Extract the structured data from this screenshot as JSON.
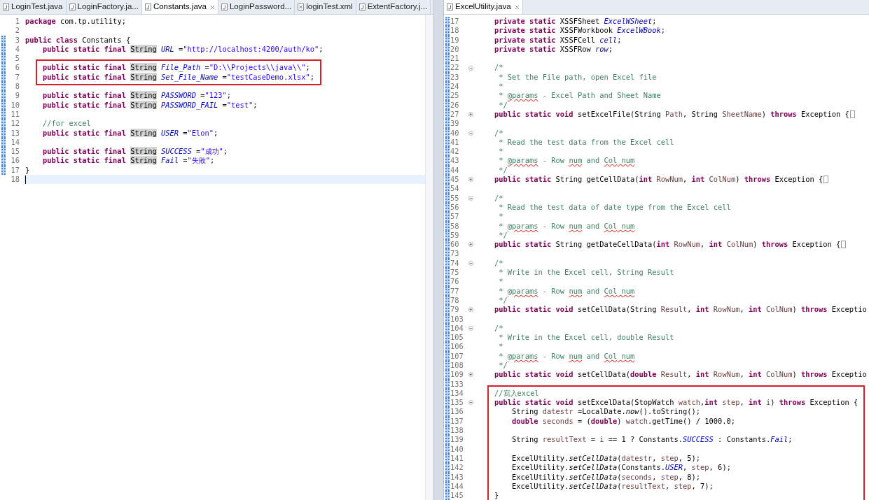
{
  "panes": [
    {
      "tabs": [
        {
          "label": "LoginTest.java",
          "kind": "java",
          "selected": false
        },
        {
          "label": "LoginFactory.ja...",
          "kind": "java",
          "selected": false
        },
        {
          "label": "Constants.java",
          "kind": "java",
          "selected": true
        },
        {
          "label": "LoginPassword...",
          "kind": "java",
          "selected": false
        },
        {
          "label": "loginTest.xml",
          "kind": "xml",
          "selected": false
        },
        {
          "label": "ExtentFactory.j...",
          "kind": "java",
          "selected": false
        }
      ],
      "blocks": [
        {
          "boxed": false,
          "lines": [
            {
              "n": "1",
              "changed": false,
              "segs": [
                {
                  "kind": "kw",
                  "text": "package"
                },
                {
                  "kind": "plain",
                  "text": " com.tp.utility;"
                }
              ]
            },
            {
              "n": "2",
              "changed": false
            },
            {
              "n": "3",
              "changed": true,
              "segs": [
                {
                  "kind": "kw",
                  "text": "public class"
                },
                {
                  "kind": "plain",
                  "text": " Constants {"
                }
              ]
            },
            {
              "n": "4",
              "changed": true,
              "segs": [
                {
                  "kind": "kw",
                  "text": "    public static final "
                },
                {
                  "kind": "hl",
                  "text": "String"
                },
                {
                  "kind": "field",
                  "text": " URL"
                },
                {
                  "kind": "plain",
                  "text": " ="
                },
                {
                  "kind": "str",
                  "text": "\"http://localhost:4200/auth/ko\""
                },
                {
                  "kind": "plain",
                  "text": ";"
                }
              ]
            },
            {
              "n": "5",
              "changed": true
            }
          ]
        },
        {
          "boxed": true,
          "lines": [
            {
              "n": "6",
              "changed": true,
              "segs": [
                {
                  "kind": "kw",
                  "text": "    public static final "
                },
                {
                  "kind": "hl",
                  "text": "String"
                },
                {
                  "kind": "field",
                  "text": " File_Path"
                },
                {
                  "kind": "plain",
                  "text": " ="
                },
                {
                  "kind": "str",
                  "text": "\"D:\\\\Projects\\\\java\\\\\""
                },
                {
                  "kind": "plain",
                  "text": ";"
                }
              ]
            },
            {
              "n": "7",
              "changed": true,
              "segs": [
                {
                  "kind": "kw",
                  "text": "    public static final "
                },
                {
                  "kind": "hl",
                  "text": "String"
                },
                {
                  "kind": "field",
                  "text": " Set_File_Name"
                },
                {
                  "kind": "plain",
                  "text": " ="
                },
                {
                  "kind": "str",
                  "text": "\"testCaseDemo.xlsx\""
                },
                {
                  "kind": "plain",
                  "text": ";"
                }
              ]
            }
          ]
        },
        {
          "boxed": false,
          "lines": [
            {
              "n": "8",
              "changed": true
            },
            {
              "n": "9",
              "changed": true,
              "segs": [
                {
                  "kind": "kw",
                  "text": "    public static final "
                },
                {
                  "kind": "hl",
                  "text": "String"
                },
                {
                  "kind": "field",
                  "text": " PASSWORD"
                },
                {
                  "kind": "plain",
                  "text": " ="
                },
                {
                  "kind": "str",
                  "text": "\"123\""
                },
                {
                  "kind": "plain",
                  "text": ";"
                }
              ]
            },
            {
              "n": "10",
              "changed": true,
              "segs": [
                {
                  "kind": "kw",
                  "text": "    public static final "
                },
                {
                  "kind": "hl",
                  "text": "String"
                },
                {
                  "kind": "field",
                  "text": " PASSWORD_FAIL"
                },
                {
                  "kind": "plain",
                  "text": " ="
                },
                {
                  "kind": "str",
                  "text": "\"test\""
                },
                {
                  "kind": "plain",
                  "text": ";"
                }
              ]
            },
            {
              "n": "11",
              "changed": true
            },
            {
              "n": "12",
              "changed": true,
              "segs": [
                {
                  "kind": "comment",
                  "text": "    //for excel"
                }
              ]
            },
            {
              "n": "13",
              "changed": true,
              "segs": [
                {
                  "kind": "kw",
                  "text": "    public static final "
                },
                {
                  "kind": "hl",
                  "text": "String"
                },
                {
                  "kind": "field",
                  "text": " USER"
                },
                {
                  "kind": "plain",
                  "text": " ="
                },
                {
                  "kind": "str",
                  "text": "\"Elon\""
                },
                {
                  "kind": "plain",
                  "text": ";"
                }
              ]
            },
            {
              "n": "14",
              "changed": true
            },
            {
              "n": "15",
              "changed": true,
              "segs": [
                {
                  "kind": "kw",
                  "text": "    public static final "
                },
                {
                  "kind": "hl",
                  "text": "String"
                },
                {
                  "kind": "field",
                  "text": " SUCCESS"
                },
                {
                  "kind": "plain",
                  "text": " ="
                },
                {
                  "kind": "str",
                  "text": "\"成功\""
                },
                {
                  "kind": "plain",
                  "text": ";"
                }
              ]
            },
            {
              "n": "16",
              "changed": true,
              "segs": [
                {
                  "kind": "kw",
                  "text": "    public static final "
                },
                {
                  "kind": "hl",
                  "text": "String"
                },
                {
                  "kind": "field",
                  "text": " Fail"
                },
                {
                  "kind": "plain",
                  "text": " ="
                },
                {
                  "kind": "str",
                  "text": "\"失敗\""
                },
                {
                  "kind": "plain",
                  "text": ";"
                }
              ]
            },
            {
              "n": "17",
              "changed": true,
              "segs": [
                {
                  "kind": "plain",
                  "text": "}"
                }
              ]
            },
            {
              "n": "18",
              "changed": false,
              "current": true
            }
          ]
        }
      ]
    },
    {
      "tabs": [
        {
          "label": "ExcelUtility.java",
          "kind": "java",
          "selected": true
        }
      ],
      "blocks": [
        {
          "boxed": false,
          "lines": [
            {
              "n": "17",
              "changed": true,
              "segs": [
                {
                  "kind": "kw",
                  "text": "    private static"
                },
                {
                  "kind": "plain",
                  "text": " XSSFSheet "
                },
                {
                  "kind": "field",
                  "text": "ExcelWSheet"
                },
                {
                  "kind": "plain",
                  "text": ";"
                }
              ]
            },
            {
              "n": "18",
              "changed": true,
              "segs": [
                {
                  "kind": "kw",
                  "text": "    private static"
                },
                {
                  "kind": "plain",
                  "text": " XSSFWorkbook "
                },
                {
                  "kind": "field",
                  "text": "ExcelWBook"
                },
                {
                  "kind": "plain",
                  "text": ";"
                }
              ]
            },
            {
              "n": "19",
              "changed": true,
              "segs": [
                {
                  "kind": "kw",
                  "text": "    private static"
                },
                {
                  "kind": "plain",
                  "text": " XSSFCell "
                },
                {
                  "kind": "field",
                  "text": "cell"
                },
                {
                  "kind": "plain",
                  "text": ";"
                }
              ]
            },
            {
              "n": "20",
              "changed": true,
              "segs": [
                {
                  "kind": "kw",
                  "text": "    private static"
                },
                {
                  "kind": "plain",
                  "text": " XSSFRow "
                },
                {
                  "kind": "field",
                  "text": "row"
                },
                {
                  "kind": "plain",
                  "text": ";"
                }
              ]
            },
            {
              "n": "21",
              "changed": true
            },
            {
              "n": "22",
              "changed": true,
              "expanded": true,
              "segs": [
                {
                  "kind": "comment",
                  "text": "    /*"
                }
              ]
            },
            {
              "n": "23",
              "changed": true,
              "segs": [
                {
                  "kind": "comment",
                  "text": "     * Set the File path, open Excel file"
                }
              ]
            },
            {
              "n": "24",
              "changed": true,
              "segs": [
                {
                  "kind": "comment",
                  "text": "     *"
                }
              ]
            },
            {
              "n": "25",
              "changed": true,
              "segs": [
                {
                  "kind": "comment",
                  "text": "     * "
                },
                {
                  "kind": "typo",
                  "text": "@params"
                },
                {
                  "kind": "comment",
                  "text": " - Excel Path and Sheet Name"
                }
              ]
            },
            {
              "n": "26",
              "changed": true,
              "segs": [
                {
                  "kind": "comment",
                  "text": "     */"
                }
              ]
            },
            {
              "n": "27",
              "changed": true,
              "expanded": false,
              "stub": true,
              "segs": [
                {
                  "kind": "kw",
                  "text": "    public static void"
                },
                {
                  "kind": "plain",
                  "text": " setExcelFile(String "
                },
                {
                  "kind": "var",
                  "text": "Path"
                },
                {
                  "kind": "plain",
                  "text": ", String "
                },
                {
                  "kind": "var",
                  "text": "SheetName"
                },
                {
                  "kind": "plain",
                  "text": ") "
                },
                {
                  "kind": "kw",
                  "text": "throws"
                },
                {
                  "kind": "plain",
                  "text": " Exception {"
                }
              ]
            },
            {
              "n": "39",
              "changed": true
            },
            {
              "n": "40",
              "changed": true,
              "expanded": true,
              "segs": [
                {
                  "kind": "comment",
                  "text": "    /*"
                }
              ]
            },
            {
              "n": "41",
              "changed": true,
              "segs": [
                {
                  "kind": "comment",
                  "text": "     * Read the test data from the Excel cell"
                }
              ]
            },
            {
              "n": "42",
              "changed": true,
              "segs": [
                {
                  "kind": "comment",
                  "text": "     *"
                }
              ]
            },
            {
              "n": "43",
              "changed": true,
              "segs": [
                {
                  "kind": "comment",
                  "text": "     * "
                },
                {
                  "kind": "typo",
                  "text": "@params"
                },
                {
                  "kind": "comment",
                  "text": " - Row "
                },
                {
                  "kind": "typo",
                  "text": "num"
                },
                {
                  "kind": "comment",
                  "text": " and "
                },
                {
                  "kind": "typo",
                  "text": "Col"
                },
                {
                  "kind": "typo",
                  "text": " num"
                }
              ]
            },
            {
              "n": "44",
              "changed": true,
              "segs": [
                {
                  "kind": "comment",
                  "text": "     */"
                }
              ]
            },
            {
              "n": "45",
              "changed": true,
              "expanded": false,
              "stub": true,
              "segs": [
                {
                  "kind": "kw",
                  "text": "    public static"
                },
                {
                  "kind": "plain",
                  "text": " String getCellData("
                },
                {
                  "kind": "kw",
                  "text": "int"
                },
                {
                  "kind": "var",
                  "text": " RowNum"
                },
                {
                  "kind": "plain",
                  "text": ", "
                },
                {
                  "kind": "kw",
                  "text": "int"
                },
                {
                  "kind": "var",
                  "text": " ColNum"
                },
                {
                  "kind": "plain",
                  "text": ") "
                },
                {
                  "kind": "kw",
                  "text": "throws"
                },
                {
                  "kind": "plain",
                  "text": " Exception {"
                }
              ]
            },
            {
              "n": "54",
              "changed": true
            },
            {
              "n": "55",
              "changed": true,
              "expanded": true,
              "segs": [
                {
                  "kind": "comment",
                  "text": "    /*"
                }
              ]
            },
            {
              "n": "56",
              "changed": true,
              "segs": [
                {
                  "kind": "comment",
                  "text": "     * Read the test data of date type from the Excel cell"
                }
              ]
            },
            {
              "n": "57",
              "changed": true,
              "segs": [
                {
                  "kind": "comment",
                  "text": "     *"
                }
              ]
            },
            {
              "n": "58",
              "changed": true,
              "segs": [
                {
                  "kind": "comment",
                  "text": "     * "
                },
                {
                  "kind": "typo",
                  "text": "@params"
                },
                {
                  "kind": "comment",
                  "text": " - Row "
                },
                {
                  "kind": "typo",
                  "text": "num"
                },
                {
                  "kind": "comment",
                  "text": " and "
                },
                {
                  "kind": "typo",
                  "text": "Col"
                },
                {
                  "kind": "typo",
                  "text": " num"
                }
              ]
            },
            {
              "n": "59",
              "changed": true,
              "segs": [
                {
                  "kind": "comment",
                  "text": "     */"
                }
              ]
            },
            {
              "n": "60",
              "changed": true,
              "expanded": false,
              "stub": true,
              "segs": [
                {
                  "kind": "kw",
                  "text": "    public static"
                },
                {
                  "kind": "plain",
                  "text": " String getDateCellData("
                },
                {
                  "kind": "kw",
                  "text": "int"
                },
                {
                  "kind": "var",
                  "text": " RowNum"
                },
                {
                  "kind": "plain",
                  "text": ", "
                },
                {
                  "kind": "kw",
                  "text": "int"
                },
                {
                  "kind": "var",
                  "text": " ColNum"
                },
                {
                  "kind": "plain",
                  "text": ") "
                },
                {
                  "kind": "kw",
                  "text": "throws"
                },
                {
                  "kind": "plain",
                  "text": " Exception {"
                }
              ]
            },
            {
              "n": "73",
              "changed": true
            },
            {
              "n": "74",
              "changed": true,
              "expanded": true,
              "segs": [
                {
                  "kind": "comment",
                  "text": "    /*"
                }
              ]
            },
            {
              "n": "75",
              "changed": true,
              "segs": [
                {
                  "kind": "comment",
                  "text": "     * Write in the Excel cell, String Result"
                }
              ]
            },
            {
              "n": "76",
              "changed": true,
              "segs": [
                {
                  "kind": "comment",
                  "text": "     *"
                }
              ]
            },
            {
              "n": "77",
              "changed": true,
              "segs": [
                {
                  "kind": "comment",
                  "text": "     * "
                },
                {
                  "kind": "typo",
                  "text": "@params"
                },
                {
                  "kind": "comment",
                  "text": " - Row "
                },
                {
                  "kind": "typo",
                  "text": "num"
                },
                {
                  "kind": "comment",
                  "text": " and "
                },
                {
                  "kind": "typo",
                  "text": "Col"
                },
                {
                  "kind": "typo",
                  "text": " num"
                }
              ]
            },
            {
              "n": "78",
              "changed": true,
              "segs": [
                {
                  "kind": "comment",
                  "text": "     */"
                }
              ]
            },
            {
              "n": "79",
              "changed": true,
              "expanded": false,
              "segs": [
                {
                  "kind": "kw",
                  "text": "    public static void"
                },
                {
                  "kind": "plain",
                  "text": " setCellData(String "
                },
                {
                  "kind": "var",
                  "text": "Result"
                },
                {
                  "kind": "plain",
                  "text": ", "
                },
                {
                  "kind": "kw",
                  "text": "int"
                },
                {
                  "kind": "var",
                  "text": " RowNum"
                },
                {
                  "kind": "plain",
                  "text": ", "
                },
                {
                  "kind": "kw",
                  "text": "int"
                },
                {
                  "kind": "var",
                  "text": " ColNum"
                },
                {
                  "kind": "plain",
                  "text": ") "
                },
                {
                  "kind": "kw",
                  "text": "throws"
                },
                {
                  "kind": "plain",
                  "text": " Exceptio"
                }
              ]
            },
            {
              "n": "103",
              "changed": true
            },
            {
              "n": "104",
              "changed": true,
              "expanded": true,
              "segs": [
                {
                  "kind": "comment",
                  "text": "    /*"
                }
              ]
            },
            {
              "n": "105",
              "changed": true,
              "segs": [
                {
                  "kind": "comment",
                  "text": "     * Write in the Excel cell, double Result"
                }
              ]
            },
            {
              "n": "106",
              "changed": true,
              "segs": [
                {
                  "kind": "comment",
                  "text": "     *"
                }
              ]
            },
            {
              "n": "107",
              "changed": true,
              "segs": [
                {
                  "kind": "comment",
                  "text": "     * "
                },
                {
                  "kind": "typo",
                  "text": "@params"
                },
                {
                  "kind": "comment",
                  "text": " - Row "
                },
                {
                  "kind": "typo",
                  "text": "num"
                },
                {
                  "kind": "comment",
                  "text": " and "
                },
                {
                  "kind": "typo",
                  "text": "Col"
                },
                {
                  "kind": "typo",
                  "text": " num"
                }
              ]
            },
            {
              "n": "108",
              "changed": true,
              "segs": [
                {
                  "kind": "comment",
                  "text": "     */"
                }
              ]
            },
            {
              "n": "109",
              "changed": true,
              "expanded": false,
              "segs": [
                {
                  "kind": "kw",
                  "text": "    public static void"
                },
                {
                  "kind": "plain",
                  "text": " setCellData("
                },
                {
                  "kind": "kw",
                  "text": "double"
                },
                {
                  "kind": "var",
                  "text": " Result"
                },
                {
                  "kind": "plain",
                  "text": ", "
                },
                {
                  "kind": "kw",
                  "text": "int"
                },
                {
                  "kind": "var",
                  "text": " RowNum"
                },
                {
                  "kind": "plain",
                  "text": ", "
                },
                {
                  "kind": "kw",
                  "text": "int"
                },
                {
                  "kind": "var",
                  "text": " ColNum"
                },
                {
                  "kind": "plain",
                  "text": ") "
                },
                {
                  "kind": "kw",
                  "text": "throws"
                },
                {
                  "kind": "plain",
                  "text": " Exceptio"
                }
              ]
            },
            {
              "n": "133",
              "changed": true
            }
          ]
        },
        {
          "boxed": true,
          "lines": [
            {
              "n": "134",
              "changed": true,
              "segs": [
                {
                  "kind": "comment",
                  "text": "    //寫入excel"
                }
              ]
            },
            {
              "n": "135",
              "changed": true,
              "expanded": true,
              "segs": [
                {
                  "kind": "kw",
                  "text": "    public static void"
                },
                {
                  "kind": "plain",
                  "text": " setExcelData(StopWatch "
                },
                {
                  "kind": "var",
                  "text": "watch"
                },
                {
                  "kind": "plain",
                  "text": ","
                },
                {
                  "kind": "kw",
                  "text": "int"
                },
                {
                  "kind": "var",
                  "text": " step"
                },
                {
                  "kind": "plain",
                  "text": ", "
                },
                {
                  "kind": "kw",
                  "text": "int"
                },
                {
                  "kind": "var",
                  "text": " i"
                },
                {
                  "kind": "plain",
                  "text": ") "
                },
                {
                  "kind": "kw",
                  "text": "throws"
                },
                {
                  "kind": "plain",
                  "text": " Exception {"
                }
              ]
            },
            {
              "n": "136",
              "changed": true,
              "segs": [
                {
                  "kind": "plain",
                  "text": "        String "
                },
                {
                  "kind": "var",
                  "text": "datestr"
                },
                {
                  "kind": "plain",
                  "text": " =LocalDate."
                },
                {
                  "kind": "method",
                  "text": "now"
                },
                {
                  "kind": "plain",
                  "text": "().toString();"
                }
              ]
            },
            {
              "n": "137",
              "changed": true,
              "segs": [
                {
                  "kind": "kw",
                  "text": "        double"
                },
                {
                  "kind": "var",
                  "text": " seconds"
                },
                {
                  "kind": "plain",
                  "text": " = ("
                },
                {
                  "kind": "kw",
                  "text": "double"
                },
                {
                  "kind": "plain",
                  "text": ") "
                },
                {
                  "kind": "var",
                  "text": "watch"
                },
                {
                  "kind": "plain",
                  "text": ".getTime() / 1000.0;"
                }
              ]
            },
            {
              "n": "138",
              "changed": true
            },
            {
              "n": "139",
              "changed": true,
              "segs": [
                {
                  "kind": "plain",
                  "text": "        String "
                },
                {
                  "kind": "var",
                  "text": "resultText"
                },
                {
                  "kind": "plain",
                  "text": " = "
                },
                {
                  "kind": "var",
                  "text": "i"
                },
                {
                  "kind": "plain",
                  "text": " == 1 ? Constants."
                },
                {
                  "kind": "field",
                  "text": "SUCCESS"
                },
                {
                  "kind": "plain",
                  "text": " : Constants."
                },
                {
                  "kind": "field",
                  "text": "Fail"
                },
                {
                  "kind": "plain",
                  "text": ";"
                }
              ]
            },
            {
              "n": "140",
              "changed": true
            },
            {
              "n": "141",
              "changed": true,
              "segs": [
                {
                  "kind": "plain",
                  "text": "        ExcelUtility."
                },
                {
                  "kind": "method",
                  "text": "setCellData"
                },
                {
                  "kind": "plain",
                  "text": "("
                },
                {
                  "kind": "var",
                  "text": "datestr"
                },
                {
                  "kind": "plain",
                  "text": ", "
                },
                {
                  "kind": "var",
                  "text": "step"
                },
                {
                  "kind": "plain",
                  "text": ", 5);"
                }
              ]
            },
            {
              "n": "142",
              "changed": true,
              "segs": [
                {
                  "kind": "plain",
                  "text": "        ExcelUtility."
                },
                {
                  "kind": "method",
                  "text": "setCellData"
                },
                {
                  "kind": "plain",
                  "text": "(Constants."
                },
                {
                  "kind": "field",
                  "text": "USER"
                },
                {
                  "kind": "plain",
                  "text": ", "
                },
                {
                  "kind": "var",
                  "text": "step"
                },
                {
                  "kind": "plain",
                  "text": ", 6);"
                }
              ]
            },
            {
              "n": "143",
              "changed": true,
              "segs": [
                {
                  "kind": "plain",
                  "text": "        ExcelUtility."
                },
                {
                  "kind": "method",
                  "text": "setCellData"
                },
                {
                  "kind": "plain",
                  "text": "("
                },
                {
                  "kind": "var",
                  "text": "seconds"
                },
                {
                  "kind": "plain",
                  "text": ", "
                },
                {
                  "kind": "var",
                  "text": "step"
                },
                {
                  "kind": "plain",
                  "text": ", 8);"
                }
              ]
            },
            {
              "n": "144",
              "changed": true,
              "segs": [
                {
                  "kind": "plain",
                  "text": "        ExcelUtility."
                },
                {
                  "kind": "method",
                  "text": "setCellData"
                },
                {
                  "kind": "plain",
                  "text": "("
                },
                {
                  "kind": "var",
                  "text": "resultText"
                },
                {
                  "kind": "plain",
                  "text": ", "
                },
                {
                  "kind": "var",
                  "text": "step"
                },
                {
                  "kind": "plain",
                  "text": ", 7);"
                }
              ]
            },
            {
              "n": "145",
              "changed": true,
              "segs": [
                {
                  "kind": "plain",
                  "text": "    }"
                }
              ]
            }
          ]
        }
      ]
    }
  ]
}
